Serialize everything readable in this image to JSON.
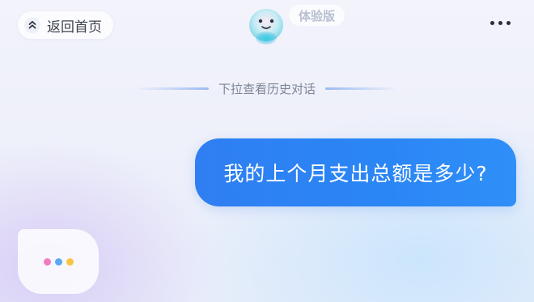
{
  "header": {
    "back_label": "返回首页",
    "badge_label": "体验版"
  },
  "history_hint": "下拉查看历史对话",
  "messages": {
    "user": "我的上个月支出总额是多少?"
  },
  "icons": {
    "back": "chevron-up-double-icon",
    "more": "more-dots-icon",
    "mascot": "assistant-mascot-icon",
    "typing": "typing-indicator-icon"
  },
  "colors": {
    "user_bubble": "#2b86f5",
    "typing_dots": [
      "#f07cc0",
      "#5aa8f5",
      "#f5c542"
    ]
  }
}
